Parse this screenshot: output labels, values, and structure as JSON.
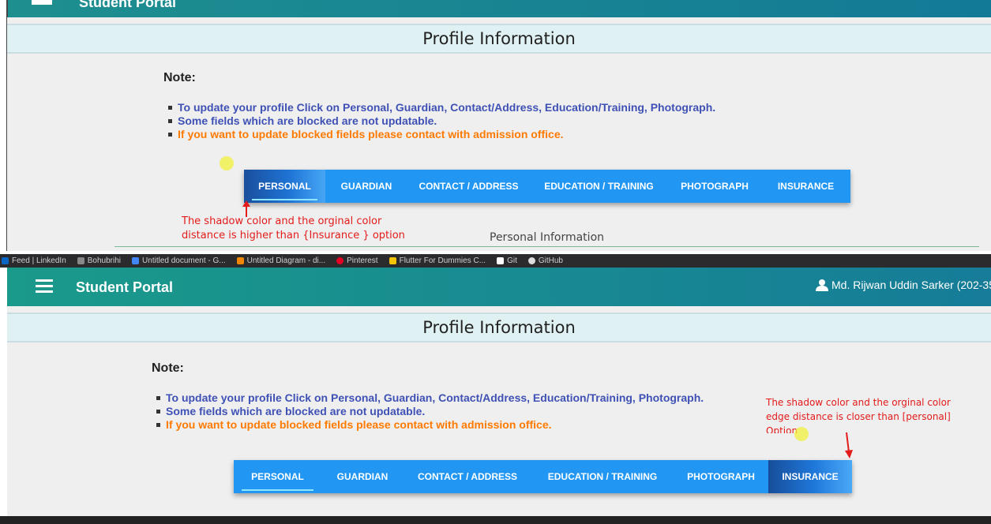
{
  "top": {
    "header_title_fragment": "Student Portal",
    "profile_title": "Profile Information",
    "note_title": "Note:",
    "notes": [
      "To update your profile Click on Personal, Guardian, Contact/Address, Education/Training, Photograph.",
      "Some fields which are blocked are not updatable.",
      "If you want to update blocked fields please contact with admission office."
    ],
    "tabs": [
      "PERSONAL",
      "GUARDIAN",
      "CONTACT / ADDRESS",
      "EDUCATION / TRAINING",
      "PHOTOGRAPH",
      "INSURANCE"
    ],
    "annotation_line1": "The shadow color and the orginal color",
    "annotation_line2": "distance is higher than {Insurance } option",
    "section_title": "Personal Information"
  },
  "bookmarks": [
    {
      "label": "Feed | LinkedIn",
      "color": "#0a66c2"
    },
    {
      "label": "Bohubrihi",
      "color": "#888888"
    },
    {
      "label": "Untitled document - G...",
      "color": "#4285f4"
    },
    {
      "label": "Untitled Diagram - di...",
      "color": "#f08705"
    },
    {
      "label": "Pinterest",
      "color": "#e60023"
    },
    {
      "label": "Flutter For Dummies C...",
      "color": "#f5c400"
    },
    {
      "label": "Git",
      "color": "#ffffff"
    },
    {
      "label": "GitHub",
      "color": "#dddddd"
    }
  ],
  "bottom": {
    "brand": "Student Portal",
    "user_name": "Md. Rijwan Uddin Sarker (202-35-",
    "profile_title": "Profile Information",
    "note_title": "Note:",
    "notes": [
      "To update your profile Click on Personal, Guardian, Contact/Address, Education/Training, Photograph.",
      "Some fields which are blocked are not updatable.",
      "If you want to update blocked fields please contact with admission office."
    ],
    "tabs": [
      "PERSONAL",
      "GUARDIAN",
      "CONTACT / ADDRESS",
      "EDUCATION / TRAINING",
      "PHOTOGRAPH",
      "INSURANCE"
    ],
    "annotation_line1": "The shadow color and the orginal color",
    "annotation_line2": "edge distance is closer than [personal]",
    "annotation_line3": "Option"
  },
  "colors": {
    "tab_bar": "#2196f3",
    "annotation": "#e31b1b",
    "note_blue": "#3f51b5",
    "note_orange": "#ff7a00",
    "header_teal": "#1a9a8a"
  }
}
